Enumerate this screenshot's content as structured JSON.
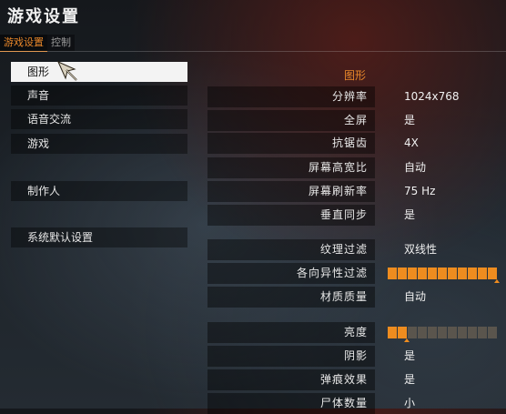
{
  "window": {
    "title": "游戏设置"
  },
  "tabs": [
    {
      "label": "游戏设置"
    },
    {
      "label": "控制"
    }
  ],
  "menu": {
    "items": [
      {
        "label": "图形"
      },
      {
        "label": "声音"
      },
      {
        "label": "语音交流"
      },
      {
        "label": "游戏"
      },
      {
        "label": "制作人"
      },
      {
        "label": "系统默认设置"
      }
    ]
  },
  "section": {
    "title": "图形"
  },
  "settings": [
    {
      "label": "分辨率",
      "value": "1024x768"
    },
    {
      "label": "全屏",
      "value": "是"
    },
    {
      "label": "抗锯齿",
      "value": "4X"
    },
    {
      "label": "屏幕高宽比",
      "value": "自动"
    },
    {
      "label": "屏幕刷新率",
      "value": "75 Hz"
    },
    {
      "label": "垂直同步",
      "value": "是"
    },
    {
      "label": "纹理过滤",
      "value": "双线性"
    },
    {
      "label": "各向异性过滤",
      "level": 1.0
    },
    {
      "label": "材质质量",
      "value": "自动"
    },
    {
      "label": "亮度",
      "level": 0.15
    },
    {
      "label": "阴影",
      "value": "是"
    },
    {
      "label": "弹痕效果",
      "value": "是"
    },
    {
      "label": "尸体数量",
      "value": "小"
    }
  ],
  "colors": {
    "accent": "#ee8c1f",
    "selected_bg": "#f3f3f3"
  },
  "icons": {
    "cursor": "arrow-pointer-icon"
  }
}
